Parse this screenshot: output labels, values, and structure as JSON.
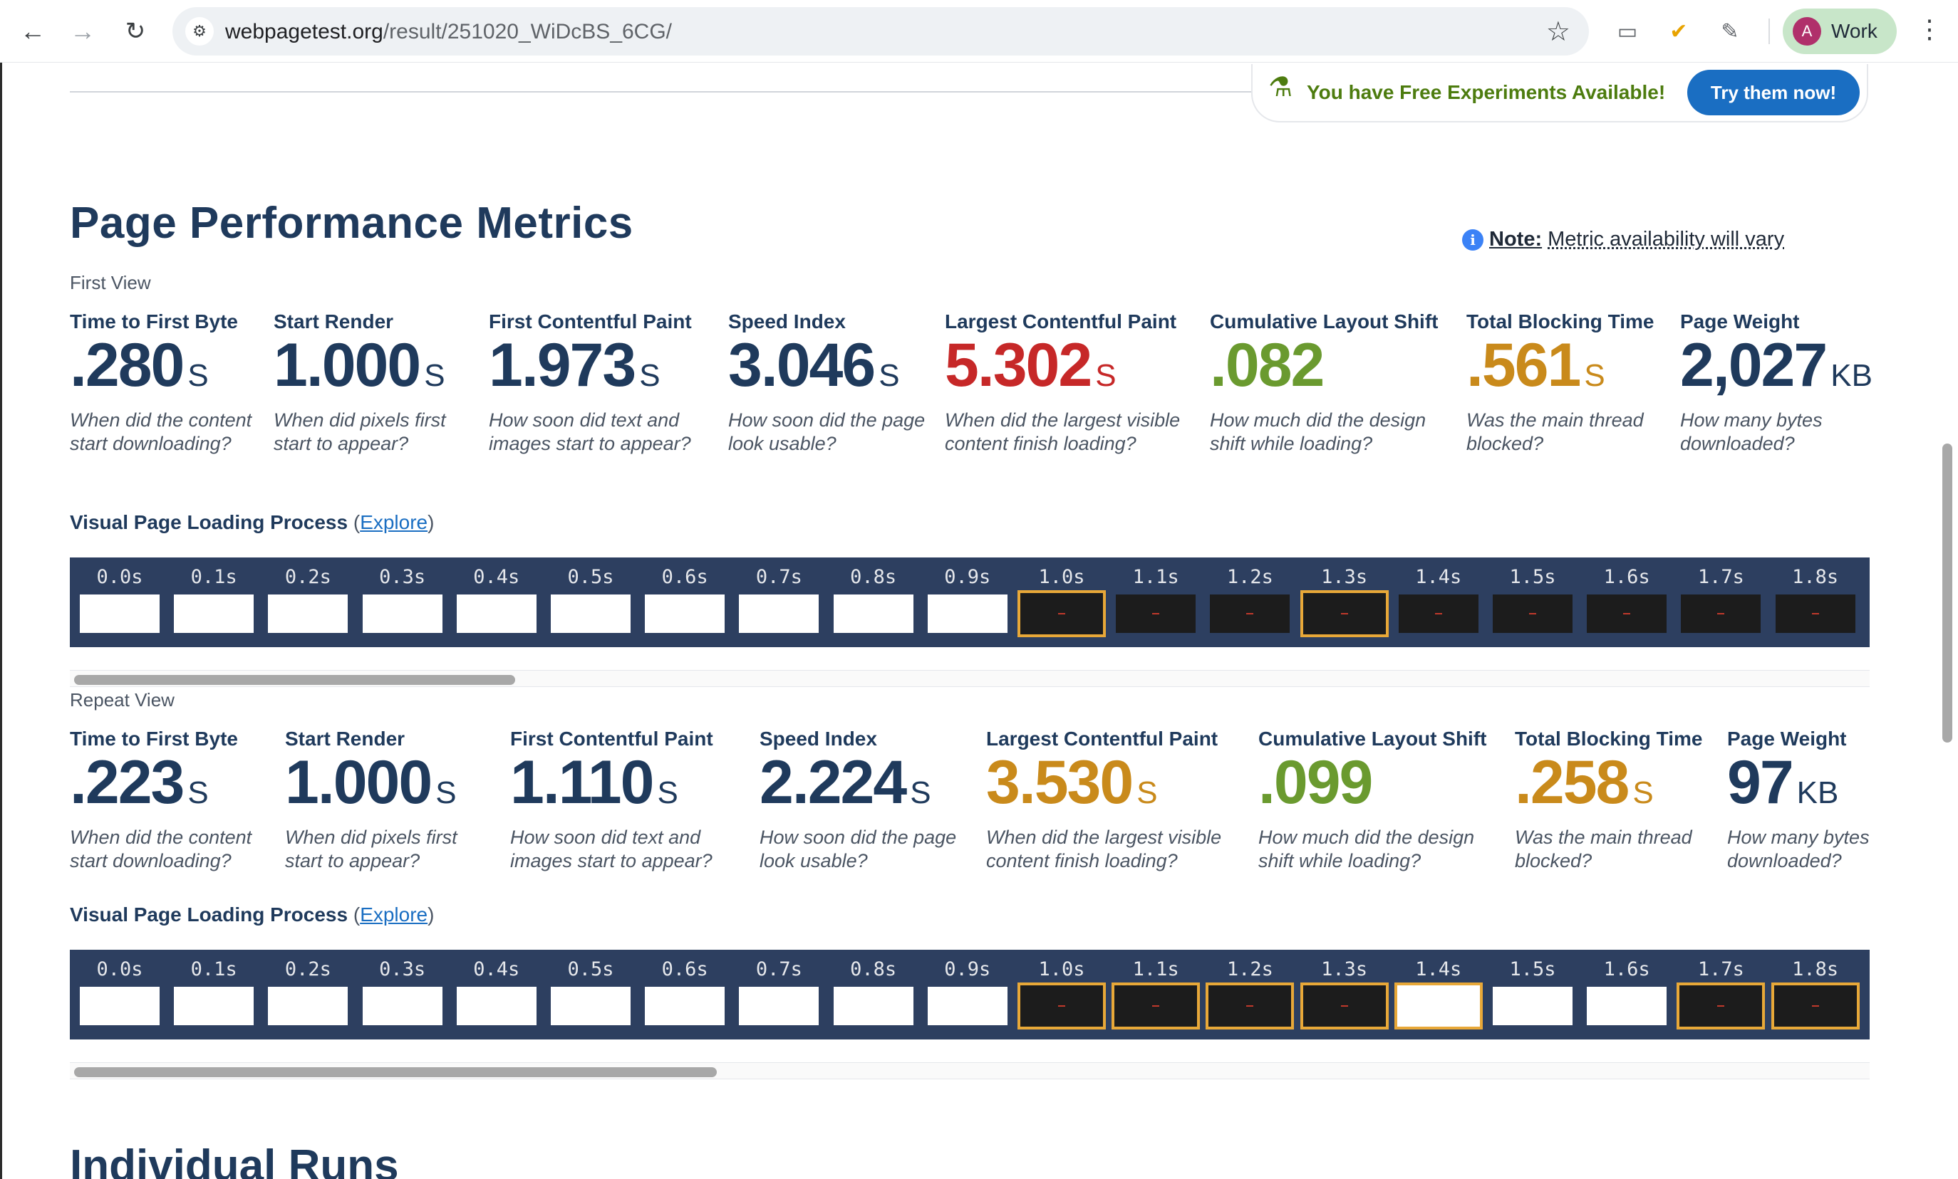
{
  "browser": {
    "url_host": "webpagetest.org",
    "url_path": "/result/251020_WiDcBS_6CG/",
    "profile_initial": "A",
    "profile_name": "Work"
  },
  "banner": {
    "text": "You have Free Experiments Available!",
    "button": "Try them now!"
  },
  "title": "Page Performance Metrics",
  "note": {
    "label": "Note:",
    "text": "Metric availability will vary"
  },
  "colors": {
    "good": "#1f3a5c",
    "ok": "#c98a1b",
    "bad": "#c62828",
    "green": "#6a9a2f"
  },
  "first_view": {
    "label": "First View",
    "metrics": [
      {
        "label": "Time to First Byte",
        "value": ".280",
        "unit": "S",
        "status": "good",
        "desc": "When did the content start downloading?"
      },
      {
        "label": "Start Render",
        "value": "1.000",
        "unit": "S",
        "status": "good",
        "desc": "When did pixels first start to appear?"
      },
      {
        "label": "First Contentful Paint",
        "value": "1.973",
        "unit": "S",
        "status": "good",
        "desc": "How soon did text and images start to appear?"
      },
      {
        "label": "Speed Index",
        "value": "3.046",
        "unit": "S",
        "status": "good",
        "desc": "How soon did the page look usable?"
      },
      {
        "label": "Largest Contentful Paint",
        "value": "5.302",
        "unit": "S",
        "status": "bad",
        "desc": "When did the largest visible content finish loading?"
      },
      {
        "label": "Cumulative Layout Shift",
        "value": ".082",
        "unit": "",
        "status": "green",
        "desc": "How much did the design shift while loading?"
      },
      {
        "label": "Total Blocking Time",
        "value": ".561",
        "unit": "S",
        "status": "ok",
        "desc": "Was the main thread blocked?"
      },
      {
        "label": "Page Weight",
        "value": "2,027",
        "unit": "KB",
        "status": "good",
        "desc": "How many bytes downloaded?"
      }
    ],
    "vplp": {
      "label": "Visual Page Loading Process",
      "link": "Explore"
    },
    "frames": [
      {
        "t": "0.0s",
        "state": "blank"
      },
      {
        "t": "0.1s",
        "state": "blank"
      },
      {
        "t": "0.2s",
        "state": "blank"
      },
      {
        "t": "0.3s",
        "state": "blank"
      },
      {
        "t": "0.4s",
        "state": "blank"
      },
      {
        "t": "0.5s",
        "state": "blank"
      },
      {
        "t": "0.6s",
        "state": "blank"
      },
      {
        "t": "0.7s",
        "state": "blank"
      },
      {
        "t": "0.8s",
        "state": "blank"
      },
      {
        "t": "0.9s",
        "state": "blank"
      },
      {
        "t": "1.0s",
        "state": "dark-changed"
      },
      {
        "t": "1.1s",
        "state": "dark"
      },
      {
        "t": "1.2s",
        "state": "dark"
      },
      {
        "t": "1.3s",
        "state": "dark-changed"
      },
      {
        "t": "1.4s",
        "state": "dark"
      },
      {
        "t": "1.5s",
        "state": "dark"
      },
      {
        "t": "1.6s",
        "state": "dark"
      },
      {
        "t": "1.7s",
        "state": "dark"
      },
      {
        "t": "1.8s",
        "state": "dark"
      }
    ],
    "scroll_fraction": 0.14
  },
  "repeat_view": {
    "label": "Repeat View",
    "metrics": [
      {
        "label": "Time to First Byte",
        "value": ".223",
        "unit": "S",
        "status": "good",
        "desc": "When did the content start downloading?"
      },
      {
        "label": "Start Render",
        "value": "1.000",
        "unit": "S",
        "status": "good",
        "desc": "When did pixels first start to appear?"
      },
      {
        "label": "First Contentful Paint",
        "value": "1.110",
        "unit": "S",
        "status": "good",
        "desc": "How soon did text and images start to appear?"
      },
      {
        "label": "Speed Index",
        "value": "2.224",
        "unit": "S",
        "status": "good",
        "desc": "How soon did the page look usable?"
      },
      {
        "label": "Largest Contentful Paint",
        "value": "3.530",
        "unit": "S",
        "status": "ok",
        "desc": "When did the largest visible content finish loading?"
      },
      {
        "label": "Cumulative Layout Shift",
        "value": ".099",
        "unit": "",
        "status": "green",
        "desc": "How much did the design shift while loading?"
      },
      {
        "label": "Total Blocking Time",
        "value": ".258",
        "unit": "S",
        "status": "ok",
        "desc": "Was the main thread blocked?"
      },
      {
        "label": "Page Weight",
        "value": "97",
        "unit": "KB",
        "status": "good",
        "desc": "How many bytes downloaded?"
      }
    ],
    "vplp": {
      "label": "Visual Page Loading Process",
      "link": "Explore"
    },
    "frames": [
      {
        "t": "0.0s",
        "state": "blank"
      },
      {
        "t": "0.1s",
        "state": "blank"
      },
      {
        "t": "0.2s",
        "state": "blank"
      },
      {
        "t": "0.3s",
        "state": "blank"
      },
      {
        "t": "0.4s",
        "state": "blank"
      },
      {
        "t": "0.5s",
        "state": "blank"
      },
      {
        "t": "0.6s",
        "state": "blank"
      },
      {
        "t": "0.7s",
        "state": "blank"
      },
      {
        "t": "0.8s",
        "state": "blank"
      },
      {
        "t": "0.9s",
        "state": "blank"
      },
      {
        "t": "1.0s",
        "state": "dark-changed"
      },
      {
        "t": "1.1s",
        "state": "dark-changed"
      },
      {
        "t": "1.2s",
        "state": "dark-changed"
      },
      {
        "t": "1.3s",
        "state": "dark-changed"
      },
      {
        "t": "1.4s",
        "state": "blank-changed"
      },
      {
        "t": "1.5s",
        "state": "blank"
      },
      {
        "t": "1.6s",
        "state": "blank"
      },
      {
        "t": "1.7s",
        "state": "dark-changed"
      },
      {
        "t": "1.8s",
        "state": "dark-changed"
      }
    ],
    "scroll_fraction": 0.21
  },
  "next_section": "Individual Runs"
}
